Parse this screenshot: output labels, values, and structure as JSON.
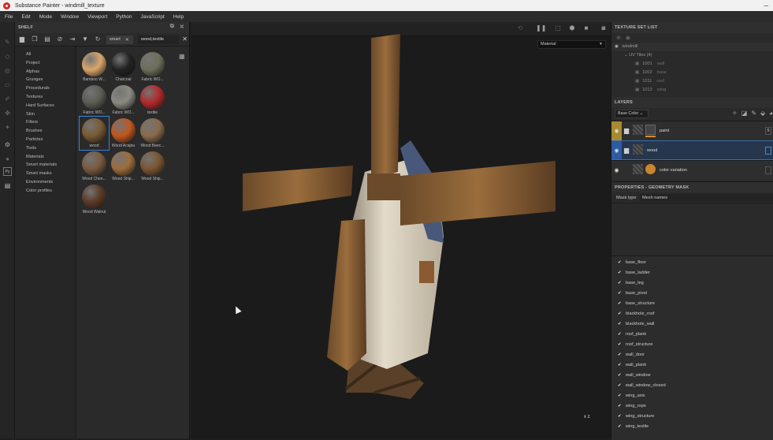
{
  "title": "Substance Painter - windmill_texture",
  "menu": [
    "File",
    "Edit",
    "Mode",
    "Window",
    "Viewport",
    "Python",
    "JavaScript",
    "Help"
  ],
  "shelf": {
    "title": "SHELF",
    "chips": [
      {
        "label": "smart"
      },
      {
        "label": "wood,textile"
      }
    ],
    "categories": [
      "All",
      "Project",
      "Alphas",
      "Grunges",
      "Procedurals",
      "Textures",
      "Hard Surfaces",
      "Skin",
      "Filters",
      "Brushes",
      "Particles",
      "Tools",
      "Materials",
      "Smart materials",
      "Smart masks",
      "Environments",
      "Color profiles"
    ],
    "materials": [
      {
        "label": "Bamboo W...",
        "color": "#d9a66c"
      },
      {
        "label": "Charcoal",
        "color": "#222222"
      },
      {
        "label": "Fabric WO...",
        "color": "#6f6f5a"
      },
      {
        "label": "Fabric WO...",
        "color": "#5b5d52"
      },
      {
        "label": "Fabric WO...",
        "color": "#8a8a80"
      },
      {
        "label": "textile",
        "color": "#b3292c"
      },
      {
        "label": "wood",
        "color": "#7a5a34"
      },
      {
        "label": "Wood Acajou",
        "color": "#c0571f"
      },
      {
        "label": "Wood Beec...",
        "color": "#8a6a4a"
      },
      {
        "label": "Wood Chen...",
        "color": "#7a5a40"
      },
      {
        "label": "Wood Ship...",
        "color": "#9e6c3a"
      },
      {
        "label": "Wood Ship...",
        "color": "#7b5532"
      },
      {
        "label": "Wood Walnut",
        "color": "#5a3a26"
      }
    ]
  },
  "viewport": {
    "render_select": "Material",
    "gizmo": "x z"
  },
  "texture_set_list": {
    "title": "TEXTURE SET LIST",
    "set_name": "windmill",
    "uv_tiles_label": "UV Tiles (4)",
    "tiles": [
      {
        "id": "1001",
        "name": "wall"
      },
      {
        "id": "1002",
        "name": "base"
      },
      {
        "id": "1011",
        "name": "roof"
      },
      {
        "id": "1012",
        "name": "wing"
      }
    ]
  },
  "layers": {
    "title": "LAYERS",
    "channel_select": "Base Color",
    "items": [
      {
        "name": "paint",
        "right": "5"
      },
      {
        "name": "wood",
        "right": ""
      },
      {
        "name": "color variation",
        "right": ""
      }
    ]
  },
  "properties": {
    "title": "PROPERTIES - GEOMETRY MASK",
    "mask_type_label": "Mask type",
    "mask_type_value": "Mesh names",
    "mesh_names": [
      "base_floor",
      "base_ladder",
      "base_leg",
      "base_pivot",
      "base_structure",
      "blackhole_roof",
      "blackhole_wall",
      "roof_plank",
      "roof_structure",
      "wall_door",
      "wall_plank",
      "wall_window",
      "wall_window_closed",
      "wing_axis",
      "wing_rope",
      "wing_structure",
      "wing_textile"
    ]
  },
  "colors": {
    "accent": "#3b7fd6",
    "selection": "#2b5aa6",
    "paint_layer": "#a88a2e",
    "orange_bar": "#e08a2a"
  }
}
